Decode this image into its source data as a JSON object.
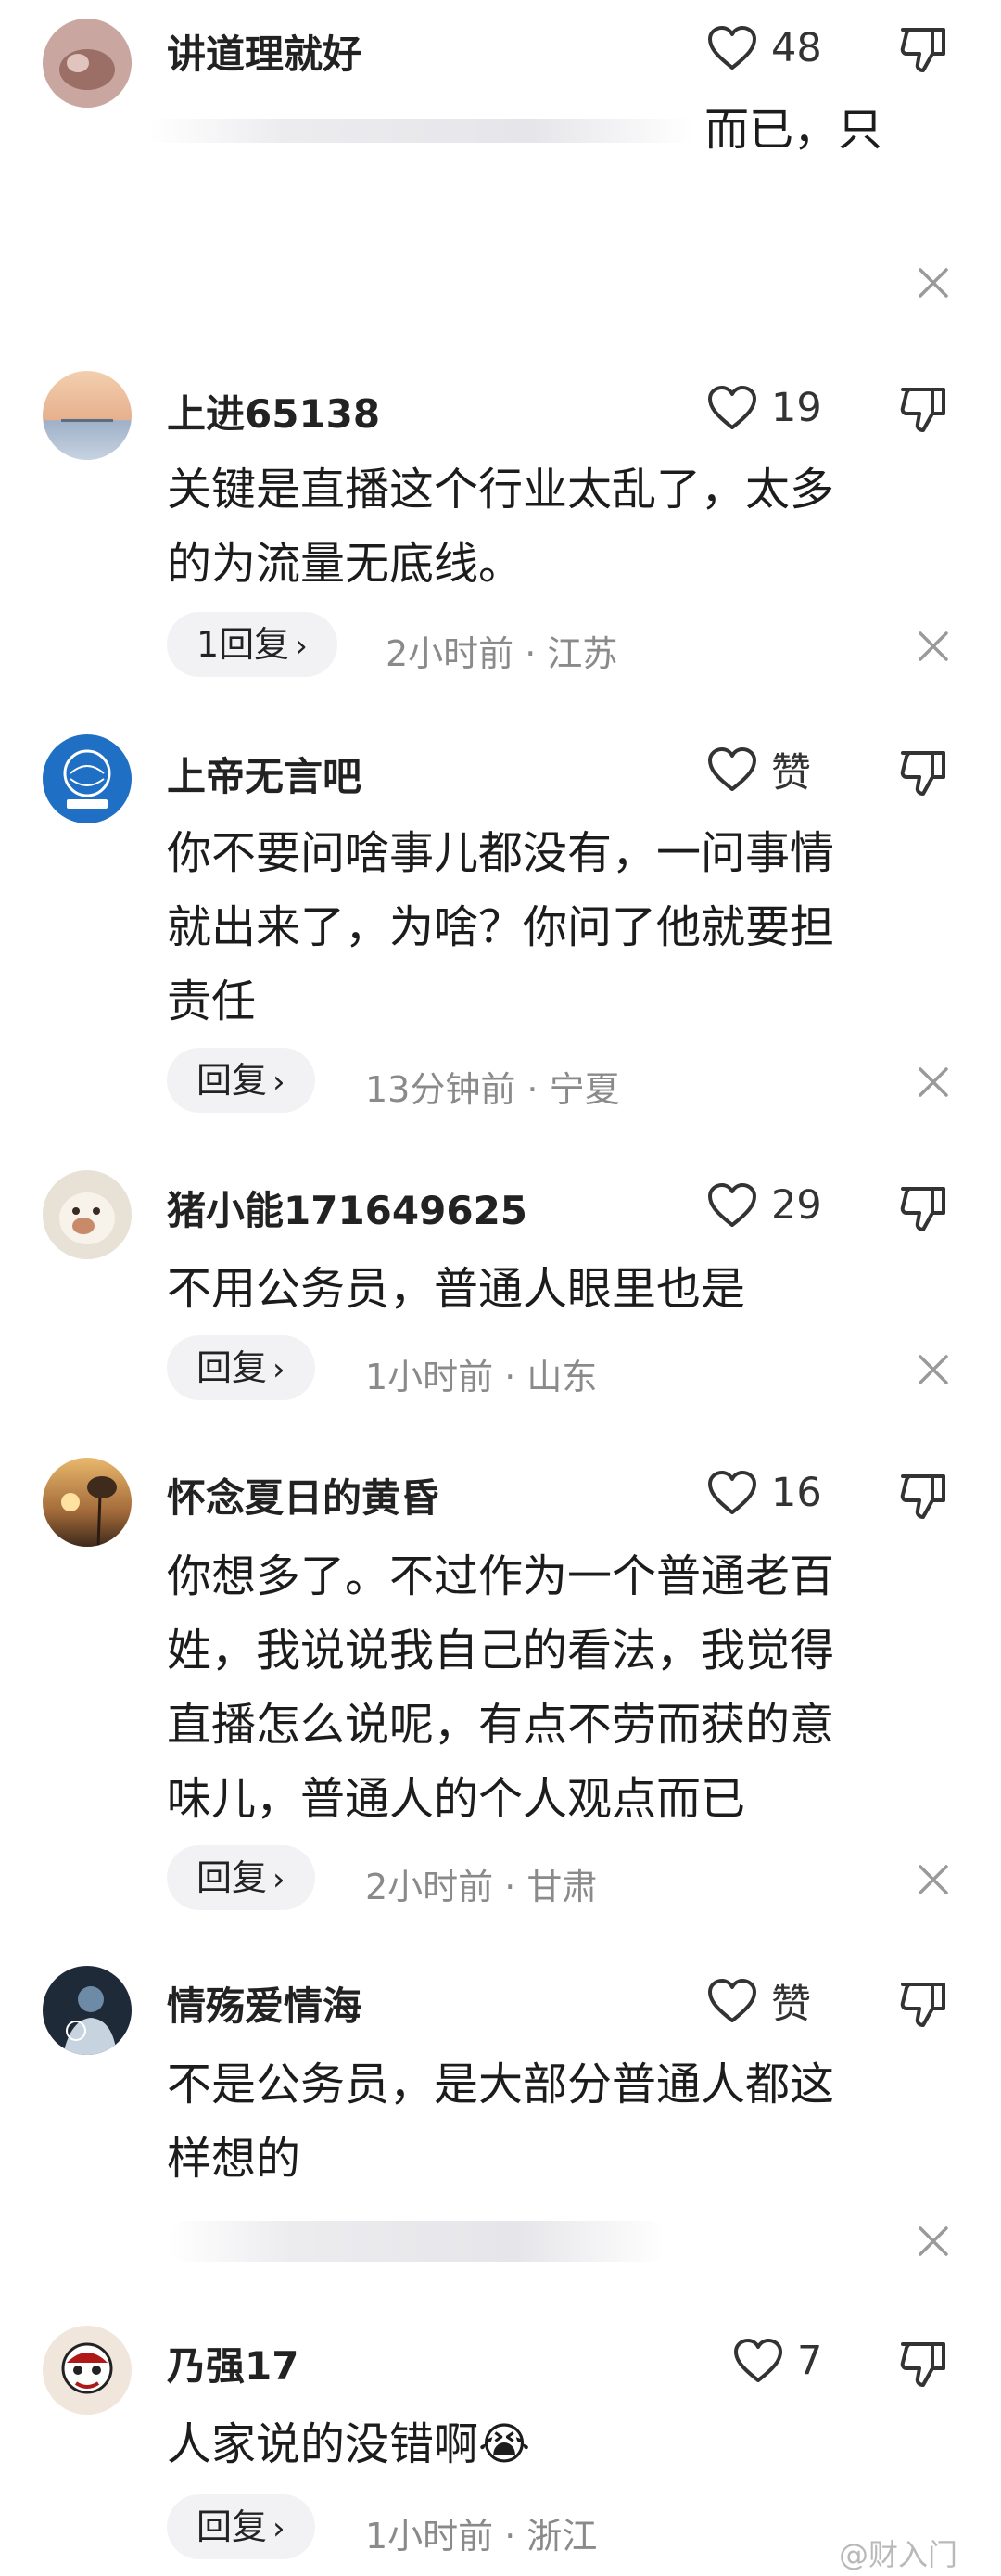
{
  "comments": [
    {
      "username": "讲道理就好",
      "likes": "48",
      "body_lines": [
        "而已，只"
      ],
      "reply_label": "",
      "meta": ""
    },
    {
      "username": "上进65138",
      "likes": "19",
      "body_lines": [
        "关键是直播这个行业太乱了，太多",
        "的为流量无底线。"
      ],
      "reply_label": "1回复",
      "meta": "2小时前 · 江苏"
    },
    {
      "username": "上帝无言吧",
      "likes": "赞",
      "body_lines": [
        "你不要问啥事儿都没有，一问事情",
        "就出来了，为啥？你问了他就要担",
        "责任"
      ],
      "reply_label": "回复",
      "meta": "13分钟前 · 宁夏"
    },
    {
      "username": "猪小能171649625",
      "likes": "29",
      "body_lines": [
        "不用公务员，普通人眼里也是"
      ],
      "reply_label": "回复",
      "meta": "1小时前 · 山东"
    },
    {
      "username": "怀念夏日的黄昏",
      "likes": "16",
      "body_lines": [
        "你想多了。不过作为一个普通老百",
        "姓，我说说我自己的看法，我觉得",
        "直播怎么说呢，有点不劳而获的意",
        "味儿，普通人的个人观点而已"
      ],
      "reply_label": "回复",
      "meta": "2小时前 · 甘肃"
    },
    {
      "username": "情殇爱情海",
      "likes": "赞",
      "body_lines": [
        "不是公务员，是大部分普通人都这",
        "样想的"
      ],
      "reply_label": "",
      "meta": ""
    },
    {
      "username": "乃强17",
      "likes": "7",
      "body_lines": [
        "人家说的没错啊😭"
      ],
      "reply_label": "回复",
      "meta": "1小时前 · 浙江"
    }
  ],
  "icons": {
    "like": "heart-outline-icon",
    "dislike": "thumbs-down-icon",
    "close": "close-icon"
  },
  "watermark": "@财入门"
}
